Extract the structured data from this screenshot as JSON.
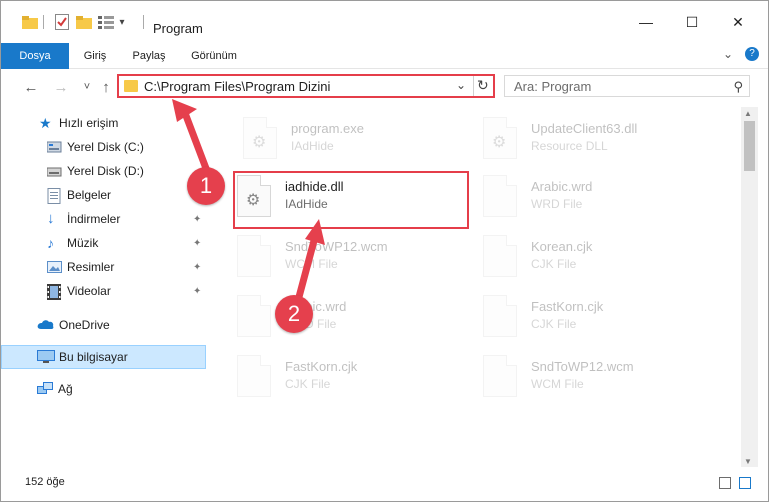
{
  "window": {
    "title": "Program",
    "minimize_glyph": "—",
    "maximize_glyph": "☐",
    "close_glyph": "✕"
  },
  "quick_access_toolbar": {
    "customize_glyph": "▾"
  },
  "ribbon": {
    "tabs": [
      "Dosya",
      "Giriş",
      "Paylaş",
      "Görünüm"
    ],
    "expand_glyph": "⌄",
    "help_glyph": "?"
  },
  "navigation": {
    "back_glyph": "←",
    "forward_glyph": "→",
    "recent_glyph": "˅",
    "up_glyph": "↑",
    "address": "C:\\Program Files\\Program Dizini",
    "address_dropdown_glyph": "⌄",
    "refresh_glyph": "↻",
    "search_placeholder": "Ara: Program",
    "search_glyph": "⚲"
  },
  "sidebar": {
    "items": [
      {
        "label": "Hızlı erişim",
        "icon": "star-icon",
        "color": "#1979ca"
      },
      {
        "label": "Yerel Disk (C:)",
        "icon": "drive-icon",
        "color": "#5b7fa6"
      },
      {
        "label": "Yerel Disk (D:)",
        "icon": "drive-icon",
        "color": "#6d6d6d"
      },
      {
        "label": "Belgeler",
        "icon": "documents-icon",
        "color": "#8aa0b8"
      },
      {
        "label": "İndirmeler",
        "icon": "download-icon",
        "color": "#2a7ad5"
      },
      {
        "label": "Müzik",
        "icon": "music-icon",
        "color": "#2a7ad5"
      },
      {
        "label": "Resimler",
        "icon": "pictures-icon",
        "color": "#5c8fc9"
      },
      {
        "label": "Videolar",
        "icon": "videos-icon",
        "color": "#3a3a3a"
      },
      {
        "label": "OneDrive",
        "icon": "cloud-icon",
        "color": "#1979ca"
      },
      {
        "label": "Bu bilgisayar",
        "icon": "computer-icon",
        "color": "#2a7ad5"
      },
      {
        "label": "Ağ",
        "icon": "network-icon",
        "color": "#2a7ad5"
      }
    ],
    "pin_glyph": "📌"
  },
  "files": [
    {
      "name": "program.exe",
      "type": "IAdHide",
      "icon": "exe-icon",
      "faded": true
    },
    {
      "name": "UpdateClient63.dll",
      "type": "Resource DLL",
      "icon": "dll-icon",
      "faded": true
    },
    {
      "name": "iadhide.dll",
      "type": "IAdHide",
      "icon": "dll-gear-icon",
      "faded": false
    },
    {
      "name": "Arabic.wrd",
      "type": "WRD File",
      "icon": "file-icon",
      "faded": true
    },
    {
      "name": "SndToWP12.wcm",
      "type": "WCM File",
      "icon": "file-icon",
      "faded": true
    },
    {
      "name": "Korean.cjk",
      "type": "CJK File",
      "icon": "file-icon",
      "faded": true
    },
    {
      "name": "Arabic.wrd",
      "type": "WRD File",
      "icon": "file-icon",
      "faded": true
    },
    {
      "name": "FastKorn.cjk",
      "type": "CJK File",
      "icon": "file-icon",
      "faded": true
    },
    {
      "name": "FastKorn.cjk",
      "type": "CJK File",
      "icon": "file-icon",
      "faded": true
    },
    {
      "name": "SndToWP12.wcm",
      "type": "WCM File",
      "icon": "file-icon",
      "faded": true
    }
  ],
  "status": {
    "item_count": "152 öğe"
  },
  "annotations": {
    "step1": "1",
    "step2": "2",
    "color": "#e5404d"
  },
  "colors": {
    "accent": "#1979ca",
    "highlight_border": "#e53e4a",
    "selection_bg": "#cce8ff"
  }
}
